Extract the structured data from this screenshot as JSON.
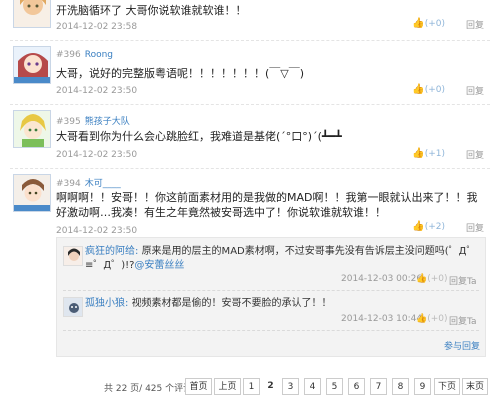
{
  "comments": [
    {
      "floor": "",
      "user": "",
      "text": "开洗脑循环了 大哥你说软谁就软谁！！",
      "time": "2014-12-02 23:58",
      "votes": "(+0)",
      "reply": "回复"
    },
    {
      "floor": "#396",
      "user": "Roong",
      "text": "大哥，说好的完整版粤语呢！！！！！！！(￣▽￣)",
      "time": "2014-12-02 23:50",
      "votes": "(+0)",
      "reply": "回复"
    },
    {
      "floor": "#395",
      "user": "熊孩子大队",
      "text": "大哥看到你为什么会心跳脸红，我难道是基佬(´°口°)´(┻━┻",
      "time": "2014-12-02 23:50",
      "votes": "(+1)",
      "reply": "回复"
    },
    {
      "floor": "#394",
      "user": "木可____",
      "text": "啊啊啊！！安哥！！你这前面素材用的是我做的MAD啊！！我第一眼就认出来了！！我好激动啊…我凑！有生之年竟然被安哥选中了！你说软谁就软谁！！",
      "time": "2014-12-02 23:50",
      "votes": "(+2)",
      "reply": "回复"
    }
  ],
  "subreplies": [
    {
      "user": "疯狂的阿给:",
      "text": "原来是用的层主的MAD素材啊，不过安哥事先没有告诉层主没问题吗(゜Д゜≡゜Д゜)!?@安蕾丝丝",
      "mention": "@安蕾丝丝",
      "time": "2014-12-03 00:26",
      "votes": "(+0)",
      "reply": "回复Ta"
    },
    {
      "user": "孤独小狼:",
      "text": "视频素材都是偷的！安哥不要脸的承认了！！",
      "time": "2014-12-03 10:44",
      "votes": "(+0)",
      "reply": "回复Ta"
    }
  ],
  "sub_footer": {
    "reply_link": "参与回复"
  },
  "pager": {
    "info": "共 22 页/ 425 个评论",
    "first": "首页",
    "prev": "上页",
    "pages": [
      "1",
      "2",
      "3",
      "4",
      "5",
      "6",
      "7",
      "8",
      "9"
    ],
    "current": "2",
    "next": "下页",
    "last": "末页"
  },
  "colors": {
    "link": "#3a7fc1",
    "vote": "#8fb5d9"
  }
}
